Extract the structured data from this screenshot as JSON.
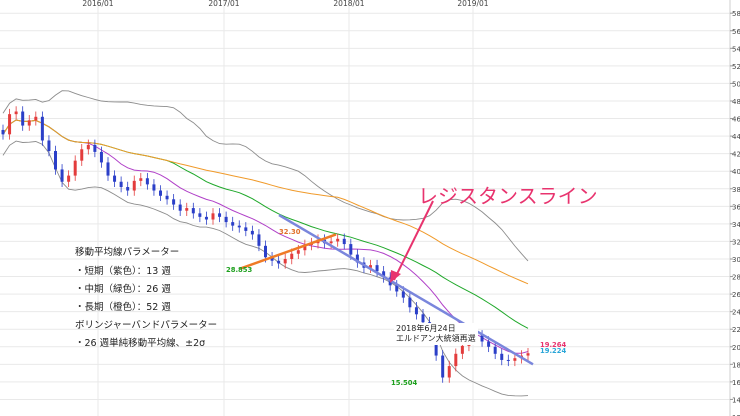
{
  "chart_data": {
    "type": "line",
    "x_ticks": [
      "2016/01",
      "2017/01",
      "2018/01",
      "2019/01"
    ],
    "y_range": [
      12.0,
      58.0
    ],
    "y_ticks": [
      "12.000",
      "14.000",
      "16.000",
      "18.000",
      "20.000",
      "22.000",
      "24.000",
      "26.000",
      "28.000",
      "30.000",
      "32.000",
      "34.000",
      "36.000",
      "38.000",
      "40.000",
      "42.000",
      "44.000",
      "46.000",
      "48.000",
      "50.000",
      "52.000",
      "54.000",
      "56.000",
      "58.000"
    ],
    "grid": true,
    "price_series": {
      "name": "",
      "values": [
        44.2,
        46.5,
        46.8,
        45.2,
        45.8,
        46.2,
        43.5,
        42.3,
        40.2,
        38.8,
        39.5,
        41.2,
        42.5,
        43.0,
        42.2,
        41.0,
        39.5,
        38.8,
        38.2,
        37.8,
        38.9,
        39.2,
        38.5,
        37.8,
        37.2,
        36.8,
        36.2,
        35.5,
        35.8,
        35.2,
        34.8,
        34.5,
        35.2,
        34.8,
        34.2,
        33.8,
        33.6,
        33.2,
        32.8,
        31.5,
        30.2,
        29.8,
        29.5,
        30.0,
        30.6,
        31.0,
        31.6,
        31.8,
        32.2,
        31.8,
        32.0,
        32.3,
        31.7,
        30.5,
        29.6,
        29.0,
        29.3,
        28.6,
        27.9,
        27.0,
        26.3,
        25.6,
        24.5,
        23.7,
        22.8,
        21.6,
        19.0,
        16.5,
        17.8,
        19.2,
        20.1,
        21.0,
        21.3,
        20.6,
        20.0,
        19.2,
        18.5,
        18.4,
        18.7,
        19.0,
        19.264
      ]
    },
    "bollinger_band": {
      "period": 26,
      "k": 2
    },
    "moving_averages": [
      {
        "period": 13,
        "color": "#b040c8"
      },
      {
        "period": 26,
        "color": "#1fa82a"
      },
      {
        "period": 52,
        "color": "#f09a2a"
      }
    ],
    "resistance_line": {
      "from": [
        0,
        35.0
      ],
      "to": [
        80,
        18.0
      ],
      "color": "#7a86dc"
    },
    "support_line": {
      "from": [
        0,
        28.9
      ],
      "to": [
        8,
        32.8
      ],
      "color": "#ef7a26"
    },
    "data_labels": [
      {
        "text": "28.853",
        "color": "#1ea01e"
      },
      {
        "text": "32.30",
        "color": "#e0702a"
      },
      {
        "text": "15.504",
        "color": "#1ea01e"
      },
      {
        "text": "19.264",
        "color": "#e8336e"
      },
      {
        "text": "19.224",
        "color": "#2aa6d8"
      }
    ]
  },
  "annotations": {
    "callout": "レジスタンスライン",
    "event_line1": "2018年6月24日",
    "event_line2": "エルドアン大統領再選",
    "params_title": "移動平均線パラメーター",
    "short": "・短期（紫色）：13 週",
    "mid": "・中期（緑色）：26 週",
    "long": "・長期（橙色）：52 週",
    "boll_title": "ボリンジャーバンドパラメーター",
    "boll": "・26 週単純移動平均線、±2σ"
  },
  "colors": {
    "up_candle": "#e33c3c",
    "down_candle": "#2b3fc8",
    "grid": "#e9e9e9",
    "band": "#8c8c8c",
    "callout_arrow": "#e8336e"
  }
}
